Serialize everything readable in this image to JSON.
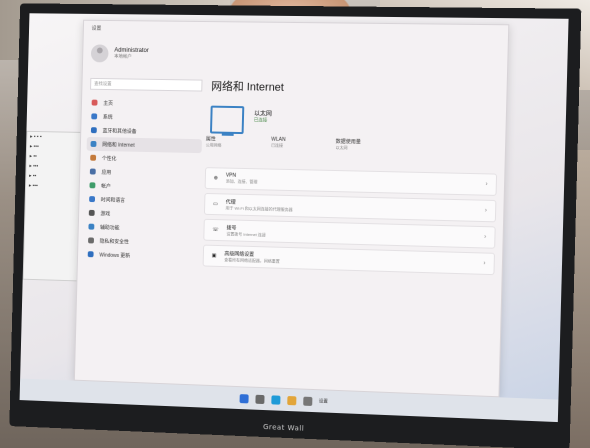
{
  "window": {
    "title": "设置"
  },
  "user": {
    "name": "Administrator",
    "role": "本地帐户"
  },
  "search": {
    "placeholder": "查找设置"
  },
  "nav": [
    {
      "label": "主页",
      "color": "#d85a5a"
    },
    {
      "label": "系统",
      "color": "#3a78c8"
    },
    {
      "label": "蓝牙和其他设备",
      "color": "#2f6fbf"
    },
    {
      "label": "网络和 Internet",
      "color": "#3b82c4"
    },
    {
      "label": "个性化",
      "color": "#c47a3b"
    },
    {
      "label": "应用",
      "color": "#4a6fa5"
    },
    {
      "label": "帐户",
      "color": "#3f9c6a"
    },
    {
      "label": "时间和语言",
      "color": "#3a78c8"
    },
    {
      "label": "游戏",
      "color": "#555555"
    },
    {
      "label": "辅助功能",
      "color": "#3b82c4"
    },
    {
      "label": "隐私和安全性",
      "color": "#6b6b6b"
    },
    {
      "label": "Windows 更新",
      "color": "#2f6fbf"
    }
  ],
  "main": {
    "title": "网络和 Internet",
    "connection": {
      "name": "以太网",
      "status": "已连接"
    },
    "props": [
      {
        "label": "属性",
        "sub": "公用网络"
      },
      {
        "label": "WLAN",
        "sub": "已连接"
      },
      {
        "label": "数据使用量",
        "sub": "以太网"
      }
    ],
    "cards": [
      {
        "label": "VPN",
        "desc": "添加、连接、管理"
      },
      {
        "label": "代理",
        "desc": "用于 Wi-Fi 和以太网连接的代理服务器"
      },
      {
        "label": "拨号",
        "desc": "设置拨号 Internet 连接"
      },
      {
        "label": "高级网络设置",
        "desc": "查看所有网络适配器，网络重置"
      }
    ]
  },
  "taskbar": {
    "label": "设置"
  },
  "brand": "Great Wall"
}
